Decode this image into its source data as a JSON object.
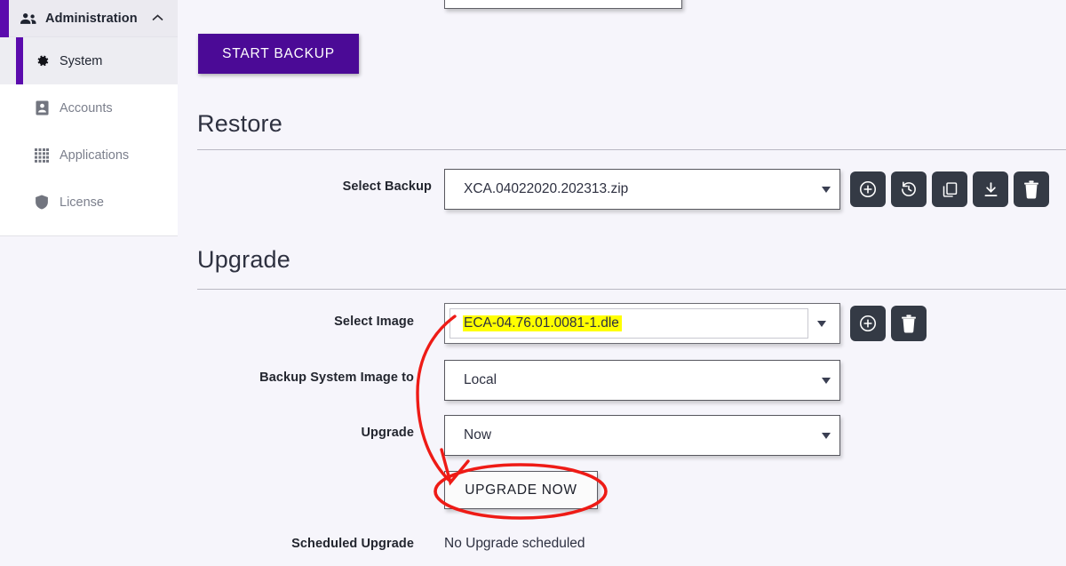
{
  "sidebar": {
    "group": {
      "label": "Administration",
      "icon": "people-icon",
      "chevron": "chevron-up-icon"
    },
    "items": [
      {
        "label": "System",
        "icon": "gear-icon",
        "active": true
      },
      {
        "label": "Accounts",
        "icon": "person-card-icon",
        "active": false
      },
      {
        "label": "Applications",
        "icon": "grid-dots-icon",
        "active": false
      },
      {
        "label": "License",
        "icon": "shield-icon",
        "active": false
      }
    ]
  },
  "backup": {
    "start_button": "START BACKUP"
  },
  "restore": {
    "title": "Restore",
    "select_backup_label": "Select Backup",
    "select_backup_value": "XCA.04022020.202313.zip",
    "actions": [
      {
        "name": "add-backup-button",
        "icon": "plus-circle-icon"
      },
      {
        "name": "restore-backup-button",
        "icon": "history-restore-icon"
      },
      {
        "name": "copy-backup-button",
        "icon": "copy-icon"
      },
      {
        "name": "download-backup-button",
        "icon": "download-icon"
      },
      {
        "name": "delete-backup-button",
        "icon": "trash-icon"
      }
    ]
  },
  "upgrade": {
    "title": "Upgrade",
    "select_image_label": "Select Image",
    "select_image_value": "ECA-04.76.01.0081-1.dle",
    "select_image_highlight": "#ffff00",
    "backup_target_label": "Backup System Image to",
    "backup_target_value": "Local",
    "upgrade_when_label": "Upgrade",
    "upgrade_when_value": "Now",
    "upgrade_now_button": "UPGRADE NOW",
    "scheduled_label": "Scheduled Upgrade",
    "scheduled_value": "No Upgrade scheduled",
    "actions": [
      {
        "name": "add-image-button",
        "icon": "plus-circle-icon"
      },
      {
        "name": "delete-image-button",
        "icon": "trash-icon"
      }
    ]
  },
  "annotation": {
    "color": "#ee1b16",
    "arrow_name": "red-arrow-annotation",
    "ellipse_name": "red-ellipse-annotation"
  },
  "theme": {
    "accent": "#4b0a96",
    "sidebar_accent": "#5b0bad",
    "page_bg": "#f6f5fb",
    "icon_button_bg": "#343a45"
  }
}
